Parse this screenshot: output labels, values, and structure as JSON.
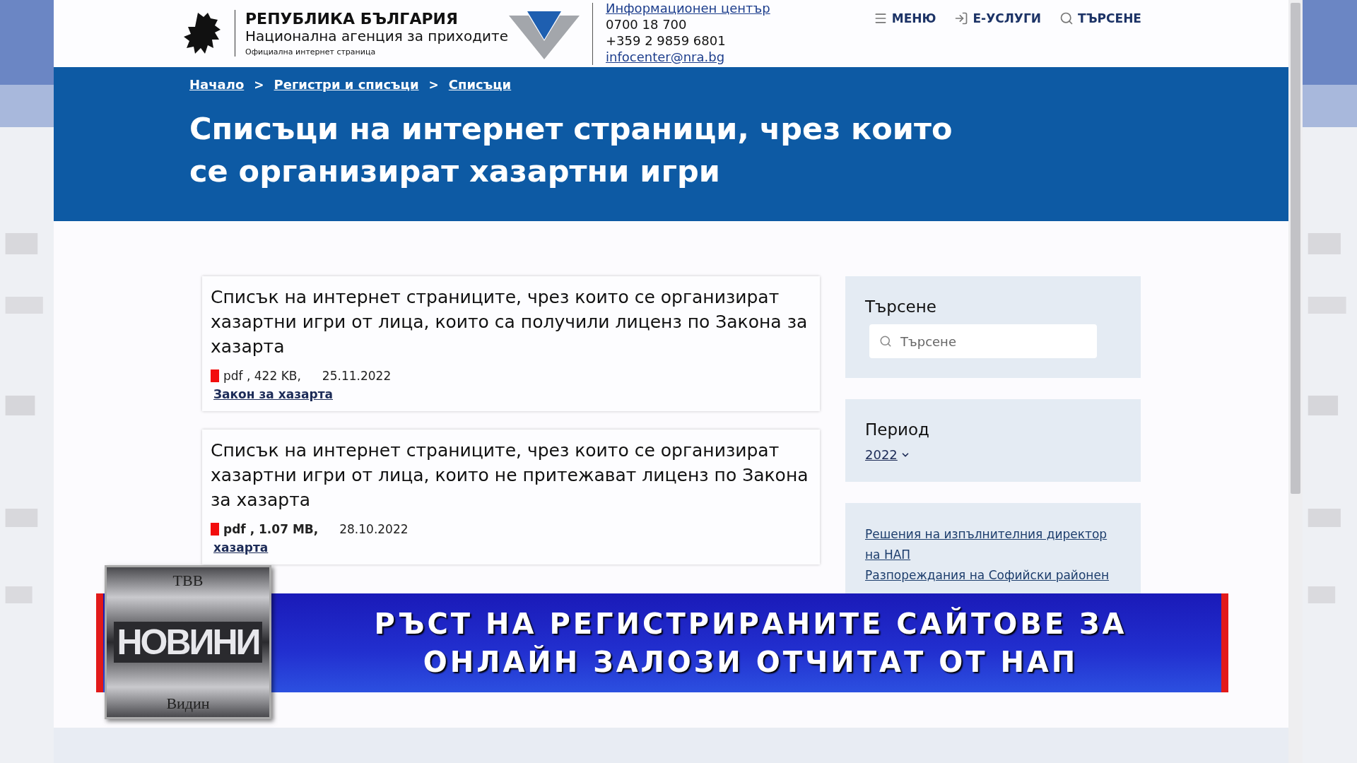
{
  "header": {
    "republic": "РЕПУБЛИКА БЪЛГАРИЯ",
    "agency": "Национална агенция за приходите",
    "tagline": "Официална интернет страница",
    "info_center": "Информационен център",
    "phone_1": "0700 18 700",
    "phone_2": "+359 2 9859 6801",
    "email": "infocenter@nra.bg"
  },
  "nav": [
    {
      "label": "МЕНЮ",
      "kind": "menu"
    },
    {
      "label": "Е-УСЛУГИ",
      "kind": "login"
    },
    {
      "label": "ТЪРСЕНЕ",
      "kind": "search"
    }
  ],
  "breadcrumbs": [
    "Начало",
    "Регистри и списъци",
    "Списъци"
  ],
  "breadcrumb_separator": ">",
  "page_title": "Списъци на интернет страници, чрез които се организират хазартни игри",
  "documents": [
    {
      "title": "Списък на интернет страниците, чрез които се организират хазартни игри от лица, които са получили лиценз по Закона за хазарта",
      "meta": "pdf , 422 KB,",
      "bold": false,
      "date": "25.11.2022",
      "link": "Закон за хазарта"
    },
    {
      "title": "Списък на интернет страниците, чрез които се организират хазартни игри от лица, които не притежават лиценз по Закона за хазарта",
      "meta": "pdf , 1.07 MB,",
      "bold": true,
      "date": "28.10.2022",
      "link": "хазарта"
    }
  ],
  "sidebar": {
    "search_title": "Търсене",
    "search_placeholder": "Търсене",
    "period_title": "Период",
    "period_value": "2022",
    "links": [
      "Решения на изпълнителния директор на НАП",
      "Разпореждания на Софийски районен"
    ]
  },
  "news_overlay": {
    "channel": "ТВВ",
    "logo_word": "НОВИНИ",
    "city": "Видин",
    "headline": [
      "РЪСТ НА РЕГИСТРИРАНИТЕ САЙТОВЕ ЗА",
      "ОНЛАЙН ЗАЛОЗИ ОТЧИТАТ ОТ НАП"
    ]
  }
}
